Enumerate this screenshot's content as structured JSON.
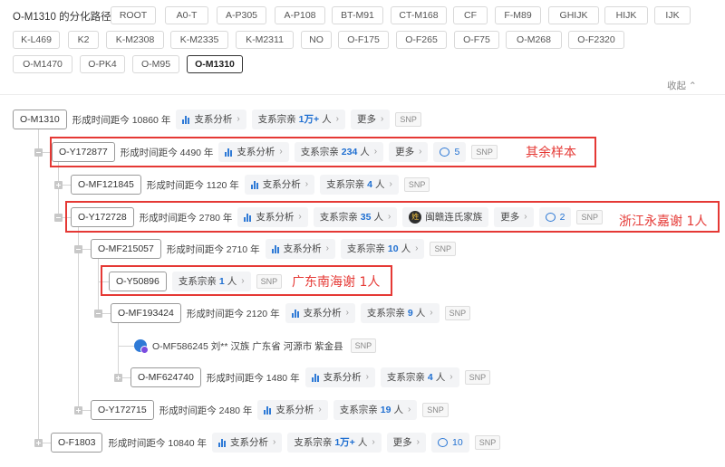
{
  "path": {
    "label": "O-M1310 的分化路径",
    "chips": [
      "ROOT",
      "A0-T",
      "A-P305",
      "A-P108",
      "BT-M91",
      "CT-M168",
      "CF",
      "F-M89",
      "GHIJK",
      "HIJK",
      "IJK",
      "K-L469",
      "K2",
      "K-M2308",
      "K-M2335",
      "K-M2311",
      "NO",
      "O-F175",
      "O-F265",
      "O-F75",
      "O-M268",
      "O-F2320",
      "O-M1470",
      "O-PK4",
      "O-M95",
      "O-M1310"
    ],
    "active": "O-M1310",
    "collapse_label": "收起"
  },
  "labels": {
    "analysis": "支系分析",
    "clan": "支系宗亲",
    "more": "更多",
    "snp": "SNP",
    "person_unit": "人"
  },
  "tree": [
    {
      "id": "O-M1310",
      "age": "形成时间距今 10860 年",
      "clan": "1万+"
    },
    {
      "id": "O-Y172877",
      "age": "形成时间距今 4490 年",
      "clan": "234",
      "comments": "5"
    },
    {
      "id": "O-MF121845",
      "age": "形成时间距今 1120 年",
      "clan": "4"
    },
    {
      "id": "O-Y172728",
      "age": "形成时间距今 2780 年",
      "clan": "35",
      "surname": "闽赣连氏家族",
      "comments": "2"
    },
    {
      "id": "O-MF215057",
      "age": "形成时间距今 2710 年",
      "clan": "10"
    },
    {
      "id": "O-Y50896",
      "clan": "1"
    },
    {
      "id": "O-MF193424",
      "age": "形成时间距今 2120 年",
      "clan": "9"
    },
    {
      "id": "O-MF586245",
      "person": "O-MF586245 刘** 汉族 广东省 河源市 紫金县"
    },
    {
      "id": "O-MF624740",
      "age": "形成时间距今 1480 年",
      "clan": "4"
    },
    {
      "id": "O-Y172715",
      "age": "形成时间距今 2480 年",
      "clan": "19"
    },
    {
      "id": "O-F1803",
      "age": "形成时间距今 10840 年",
      "clan": "1万+",
      "comments": "10"
    }
  ],
  "notes": {
    "rest": "其余样本",
    "zhejiang": "浙江永嘉谢 1人",
    "guangdong": "广东南海谢 1人"
  },
  "colors": {
    "accent": "#2f7ad6",
    "annotation": "#e53935"
  }
}
